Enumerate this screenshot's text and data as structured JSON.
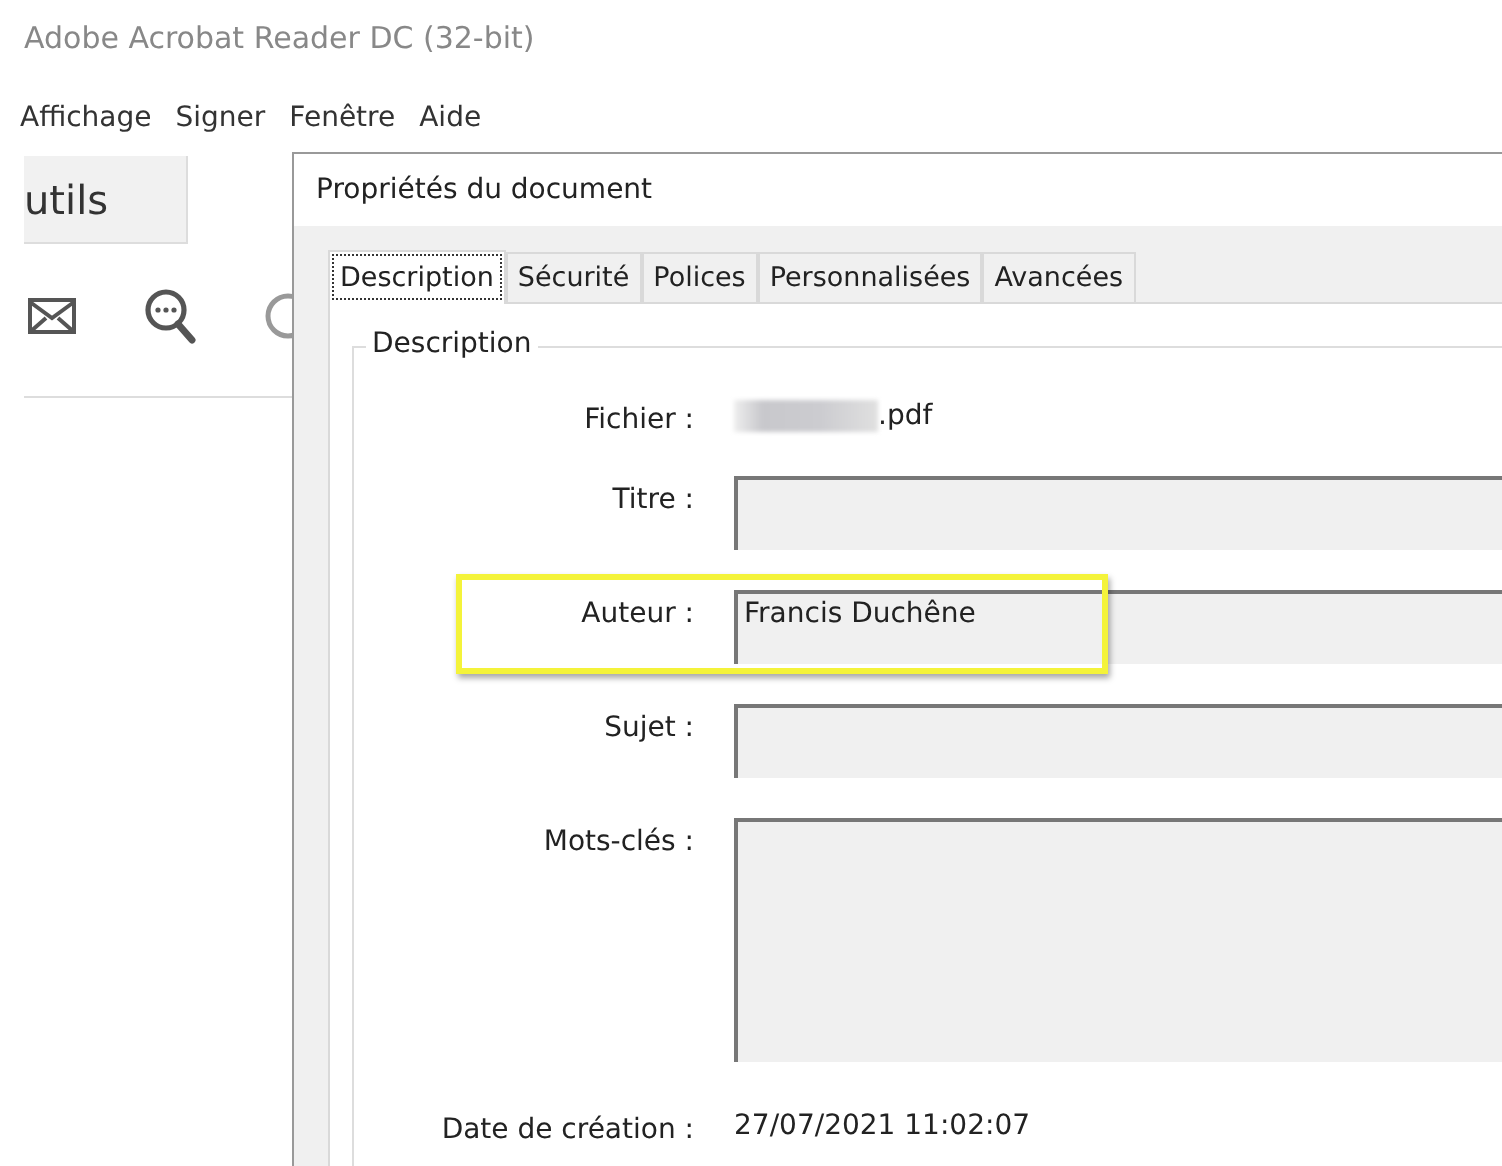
{
  "app": {
    "title": "Adobe Acrobat Reader DC (32-bit)",
    "menu": [
      "Affichage",
      "Signer",
      "Fenêtre",
      "Aide"
    ],
    "tools_tab": "utils"
  },
  "dialog": {
    "title": "Propriétés du document",
    "tabs": [
      {
        "label": "Description",
        "selected": true
      },
      {
        "label": "Sécurité",
        "selected": false
      },
      {
        "label": "Polices",
        "selected": false
      },
      {
        "label": "Personnalisées",
        "selected": false
      },
      {
        "label": "Avancées",
        "selected": false
      }
    ],
    "group_title": "Description",
    "rows": [
      {
        "kind": "text",
        "label": "Fichier :",
        "value": ".pdf",
        "redacted": true
      },
      {
        "kind": "field",
        "label": "Titre :",
        "highlighted": false
      },
      {
        "kind": "field",
        "label": "Auteur :",
        "value": "Francis Duchêne",
        "highlighted": true
      },
      {
        "kind": "field",
        "label": "Sujet :",
        "highlighted": false
      },
      {
        "kind": "area",
        "label": "Mots-clés :",
        "highlighted": false
      },
      {
        "kind": "text",
        "label": "Date de création :",
        "value": "27/07/2021 11:02:07",
        "redacted": false
      }
    ]
  }
}
